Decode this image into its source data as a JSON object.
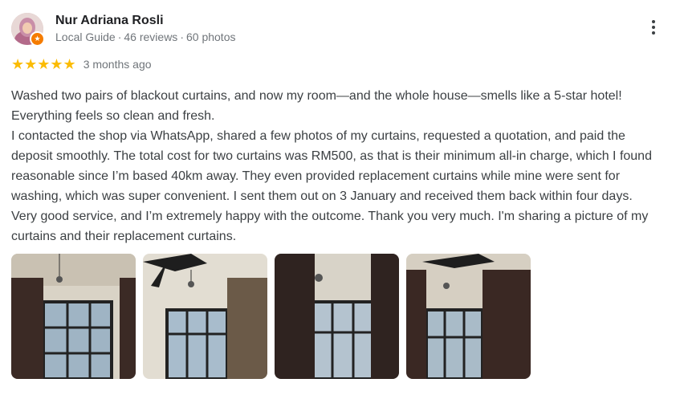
{
  "reviewer": {
    "name": "Nur Adriana Rosli",
    "guide_label": "Local Guide",
    "reviews": "46 reviews",
    "photos": "60 photos",
    "separator": "·"
  },
  "rating": {
    "stars": "★★★★★",
    "value": 5,
    "date": "3 months ago"
  },
  "review": {
    "paragraphs": [
      "Washed two pairs of blackout curtains, and now my room—and the whole house—smells like a 5-star hotel! Everything feels so clean and fresh.",
      "I contacted the shop via WhatsApp, shared a few photos of my curtains, requested a quotation, and paid the deposit smoothly. The total cost for two curtains was RM500, as that is their minimum all-in charge, which I found reasonable since I’m based 40km away. They even provided replacement curtains while mine were sent for washing, which was super convenient. I sent them out on 3 January and received them back within four days. Very good service, and I’m extremely happy with the outcome. Thank you very much. I'm sharing a picture of my curtains and their replacement curtains."
    ]
  },
  "colors": {
    "star": "#fbbc04",
    "badge": "#f57c00",
    "name": "#202124",
    "meta": "#70757a"
  },
  "icons": {
    "more": "more-vert-icon",
    "badge": "local-guide-star-icon"
  }
}
